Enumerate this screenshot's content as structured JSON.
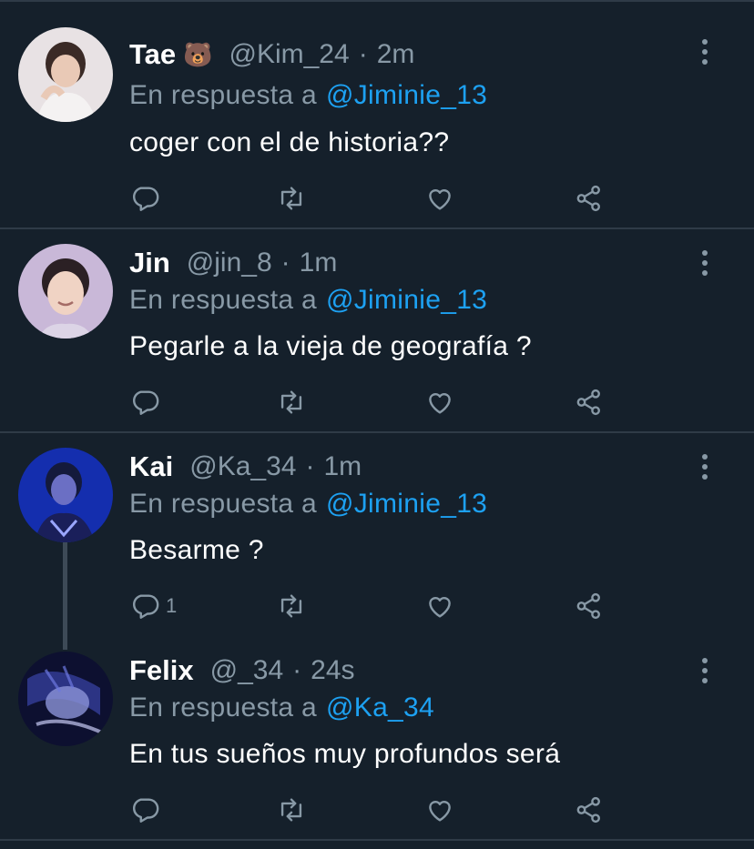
{
  "colors": {
    "background": "#15202b",
    "muted": "#8899a6",
    "mention": "#1da1f2",
    "divider": "#2f3b47"
  },
  "tweets": [
    {
      "name": "Tae",
      "emoji": "🐻",
      "handle": "@Kim_24",
      "dot": "·",
      "time": "2m",
      "reply_prefix": "En respuesta a",
      "reply_to": "@Jiminie_13",
      "text": "coger con el de historia??",
      "reply_count": "",
      "avatar_icon": "avatar-photo"
    },
    {
      "name": "Jin",
      "emoji": "",
      "handle": "@jin_8",
      "dot": "·",
      "time": "1m",
      "reply_prefix": "En respuesta a",
      "reply_to": "@Jiminie_13",
      "text": "Pegarle a la vieja de geografía ?",
      "reply_count": "",
      "avatar_icon": "avatar-photo"
    },
    {
      "name": "Kai",
      "emoji": "",
      "handle": "@Ka_34",
      "dot": "·",
      "time": "1m",
      "reply_prefix": "En respuesta a",
      "reply_to": "@Jiminie_13",
      "text": "Besarme ?",
      "reply_count": "1",
      "avatar_icon": "avatar-photo"
    },
    {
      "name": "Felix",
      "emoji": "",
      "handle": "@_34",
      "dot": "·",
      "time": "24s",
      "reply_prefix": "En respuesta a",
      "reply_to": "@Ka_34",
      "text": "En tus sueños muy profundos será",
      "reply_count": "",
      "avatar_icon": "avatar-photo"
    }
  ],
  "action_icons": [
    "reply-icon",
    "retweet-icon",
    "like-icon",
    "share-icon"
  ]
}
